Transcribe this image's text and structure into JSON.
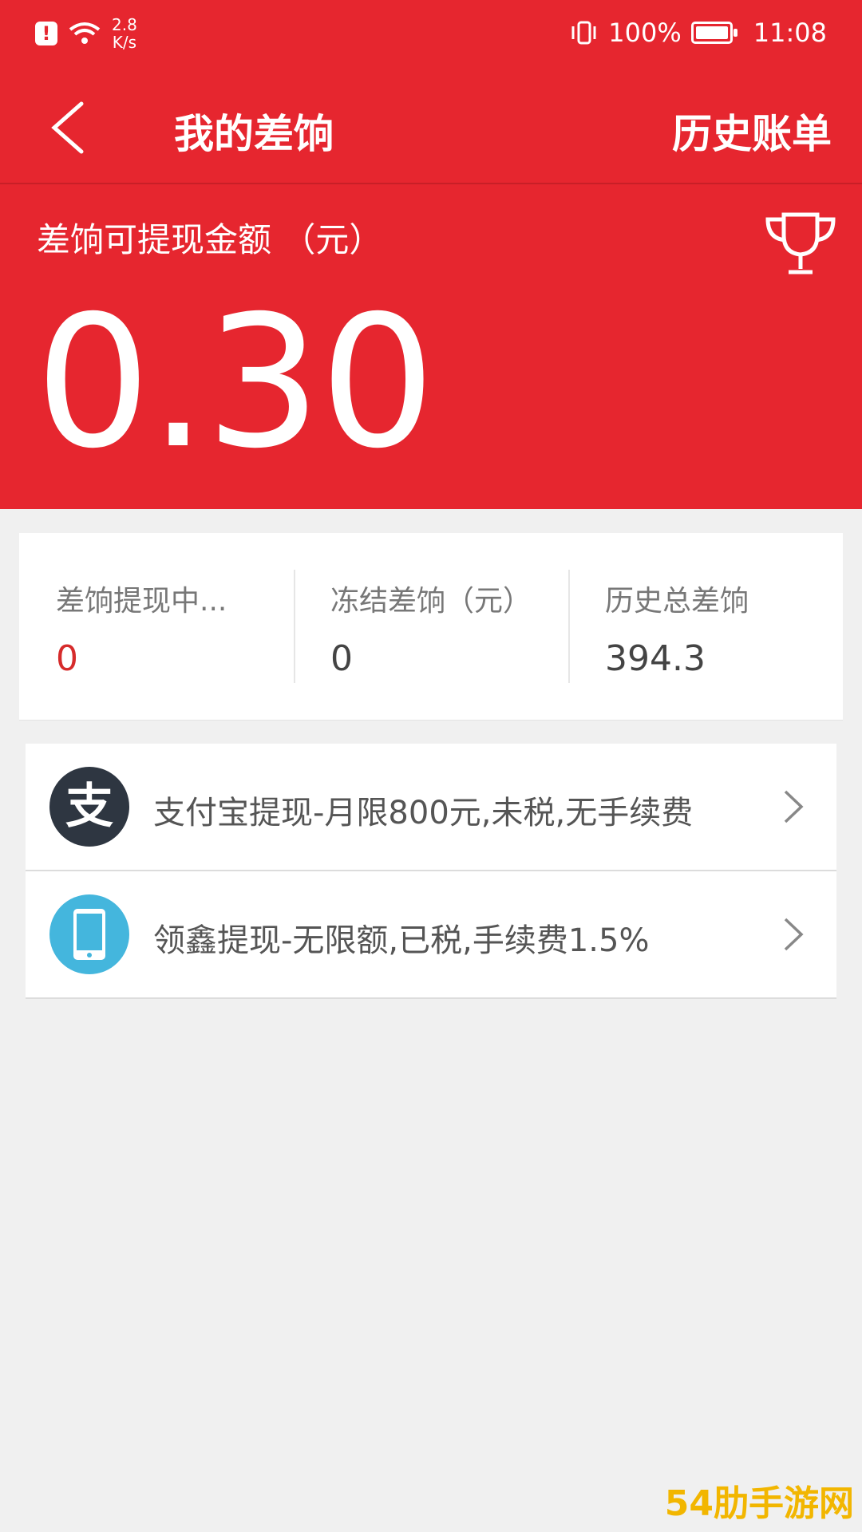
{
  "status_bar": {
    "net_speed": "2.8",
    "net_unit": "K/s",
    "battery": "100%",
    "time": "11:08"
  },
  "nav": {
    "title": "我的差饷",
    "right_action": "历史账单"
  },
  "hero": {
    "label": "差饷可提现金额 （元）",
    "amount": "0.30"
  },
  "stats": [
    {
      "label": "差饷提现中...",
      "value": "0"
    },
    {
      "label": "冻结差饷（元）",
      "value": "0"
    },
    {
      "label": "历史总差饷",
      "value": "394.3"
    }
  ],
  "withdraw_options": [
    {
      "icon": "alipay-icon",
      "icon_glyph": "支",
      "label": "支付宝提现-月限800元,未税,无手续费"
    },
    {
      "icon": "phone-icon",
      "label": "领鑫提现-无限额,已税,手续费1.5%"
    }
  ],
  "watermark": "54肋手游网",
  "colors": {
    "primary_red": "#e6262f",
    "alipay_dark": "#2e3641",
    "phone_blue": "#44b6dd"
  }
}
